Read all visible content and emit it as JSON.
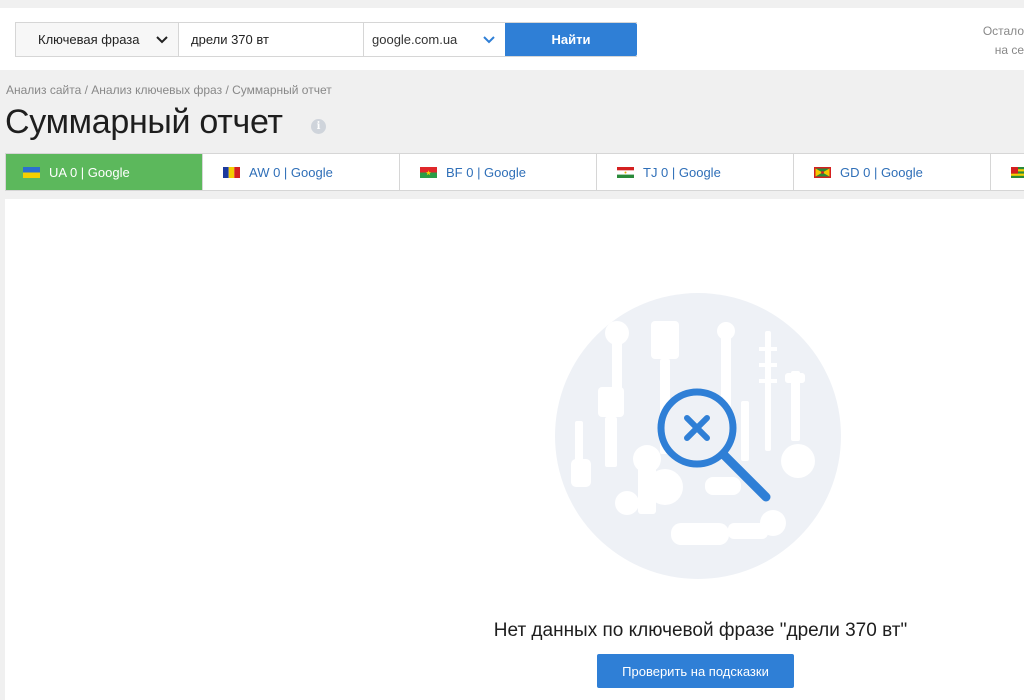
{
  "search": {
    "type_label": "Ключевая фраза",
    "query_value": "дрели 370 вт",
    "engine": "google.com.ua",
    "submit_label": "Найти"
  },
  "remaining": {
    "line1": "Остало",
    "line2": "на се"
  },
  "breadcrumb": {
    "items": [
      "Анализ сайта",
      "Анализ ключевых фраз",
      "Суммарный отчет"
    ],
    "sep": " / "
  },
  "page_title": "Суммарный отчет",
  "tabs": [
    {
      "label": "UA 0 | Google",
      "flag": "ua"
    },
    {
      "label": "AW 0 | Google",
      "flag": "aw"
    },
    {
      "label": "BF 0 | Google",
      "flag": "bf"
    },
    {
      "label": "TJ 0 | Google",
      "flag": "tj"
    },
    {
      "label": "GD 0 | Google",
      "flag": "gd"
    },
    {
      "label": "",
      "flag": "tg"
    }
  ],
  "empty_state": {
    "message": "Нет данных по ключевой фразе \"дрели 370 вт\"",
    "button_label": "Проверить на подсказки",
    "circle_color": "#eef1f6",
    "key_color": "#ffffff",
    "magnifier_color": "#2f7fd6"
  }
}
